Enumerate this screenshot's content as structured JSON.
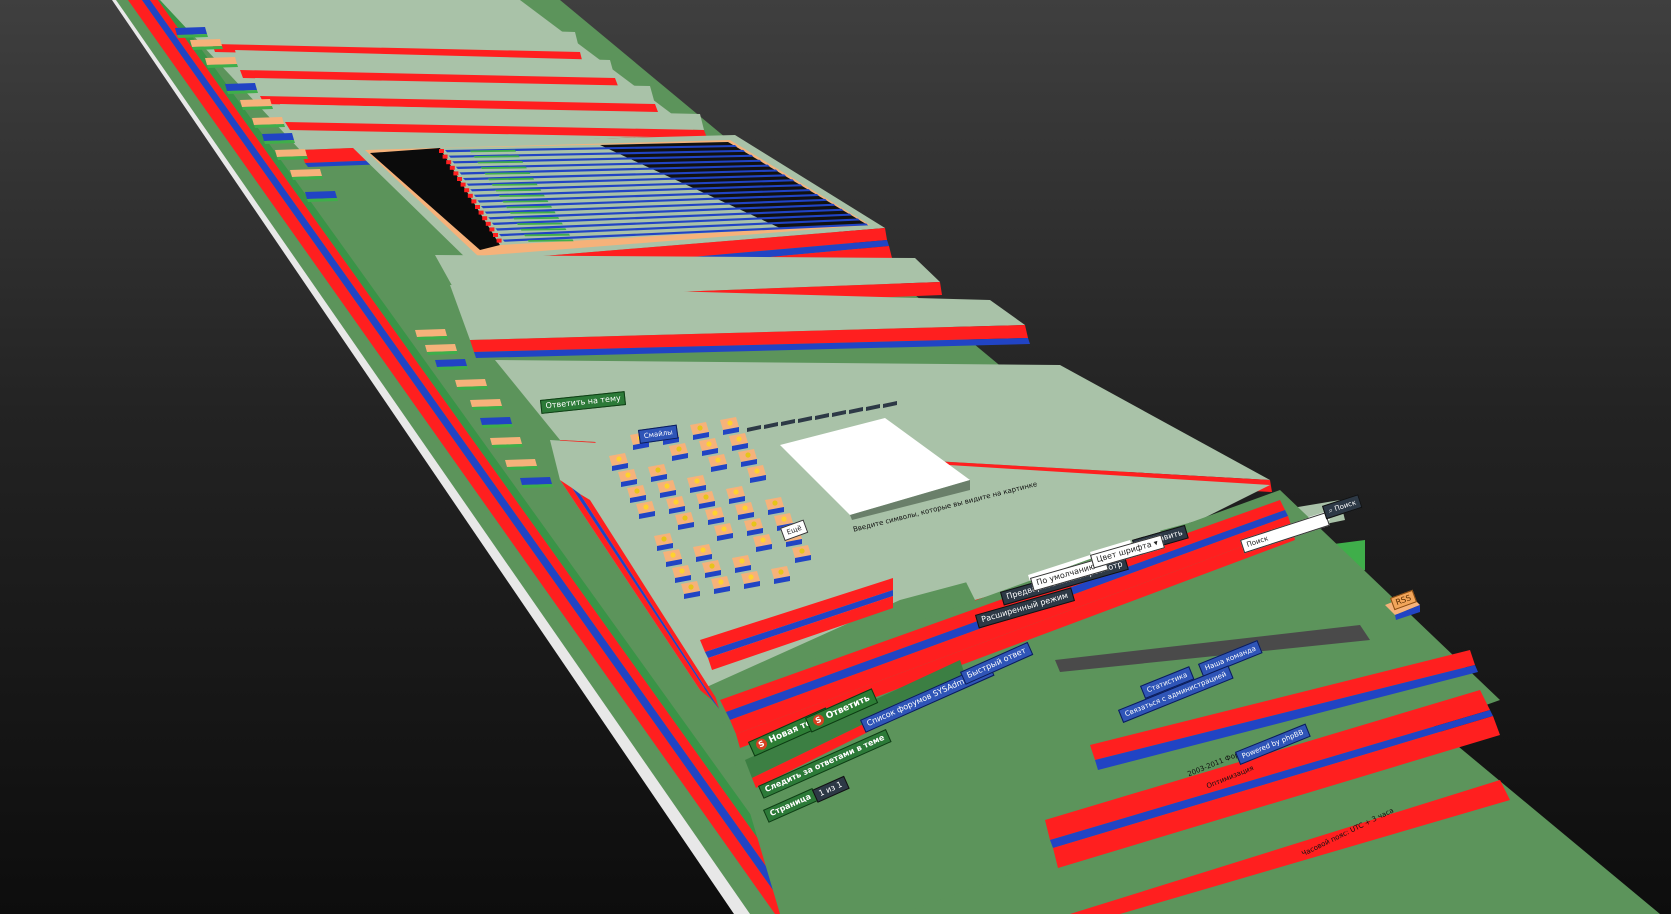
{
  "view": {
    "name": "3d-dom-inspector",
    "colors": {
      "background_top": "#3f3f3f",
      "background_bottom": "#0d0d0d",
      "surface": "#a9c2a8",
      "surface_dark": "#5c945b",
      "layer_red": "#ff1f1f",
      "layer_blue": "#2144c4",
      "layer_orange": "#f6b27a",
      "layer_green": "#3fae4a",
      "content_white": "#ffffff"
    }
  },
  "forum": {
    "search": {
      "label": "Поиск",
      "placeholder": "Поиск"
    },
    "reply_form": {
      "advanced_mode_button": "Расширенный режим",
      "preview_button": "Предварительный просмотр",
      "submit_button": "Отправить",
      "font_size_select": "По умолчанию",
      "font_color_select": "Цвет шрифта",
      "quick_reply_title": "Ответить на тему",
      "captcha_hint": "Введите символы, которые вы видите на картинке"
    },
    "actions": {
      "new_topic": "Новая тема",
      "reply": "Ответить",
      "follow_topic": "Следить за ответами в теме",
      "forum_list": "Список форумов SYSAdmins.RU",
      "pages_label": "Страница",
      "page_number": "1 из 1",
      "quick_reply_toggle": "Быстрый ответ"
    },
    "smiley_panel": {
      "title": "Смайлы",
      "more_label": "Ещё"
    },
    "footer": {
      "copyright": "2003-2011 Форум SYSAdmins.RU",
      "optimization": "Оптимизация",
      "powered_by": "Powered by phpBB",
      "time_note": "Часовой пояс: UTC + 3 часа",
      "stats_link": "Статистика",
      "team_link": "Наша команда",
      "contact_link": "Связаться с администрацией"
    },
    "orange_badge": "RSS"
  }
}
